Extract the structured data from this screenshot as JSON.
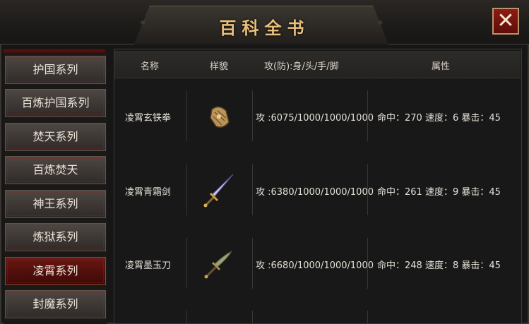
{
  "window": {
    "title": "百科全书",
    "close_label": "✕"
  },
  "sidebar": {
    "items": [
      {
        "label": "护国系列"
      },
      {
        "label": "百炼护国系列"
      },
      {
        "label": "焚天系列"
      },
      {
        "label": "百炼焚天"
      },
      {
        "label": "神王系列"
      },
      {
        "label": "炼狱系列"
      },
      {
        "label": "凌霄系列"
      },
      {
        "label": "封魔系列"
      }
    ],
    "selected": "凌霄系列"
  },
  "table": {
    "headers": {
      "name": "名称",
      "appearance": "样貌",
      "attack": "攻(防):身/头/手/脚",
      "attributes": "属性"
    },
    "rows": [
      {
        "name": "凌霄玄铁拳",
        "icon": "gauntlet-icon",
        "attack": "攻 :6075/1000/1000/1000",
        "attributes": "命中：270 速度：6 暴击：45"
      },
      {
        "name": "凌霄青霜剑",
        "icon": "sword-icon",
        "attack": "攻 :6380/1000/1000/1000",
        "attributes": "命中：261 速度：9 暴击：45"
      },
      {
        "name": "凌霄墨玉刀",
        "icon": "blade-icon",
        "attack": "攻 :6680/1000/1000/1000",
        "attributes": "命中：248 速度：8 暴击：45"
      }
    ]
  },
  "colors": {
    "title_gold": "#e9c07a",
    "close_red": "#8d1a14",
    "selected_red": "#6a1712"
  }
}
